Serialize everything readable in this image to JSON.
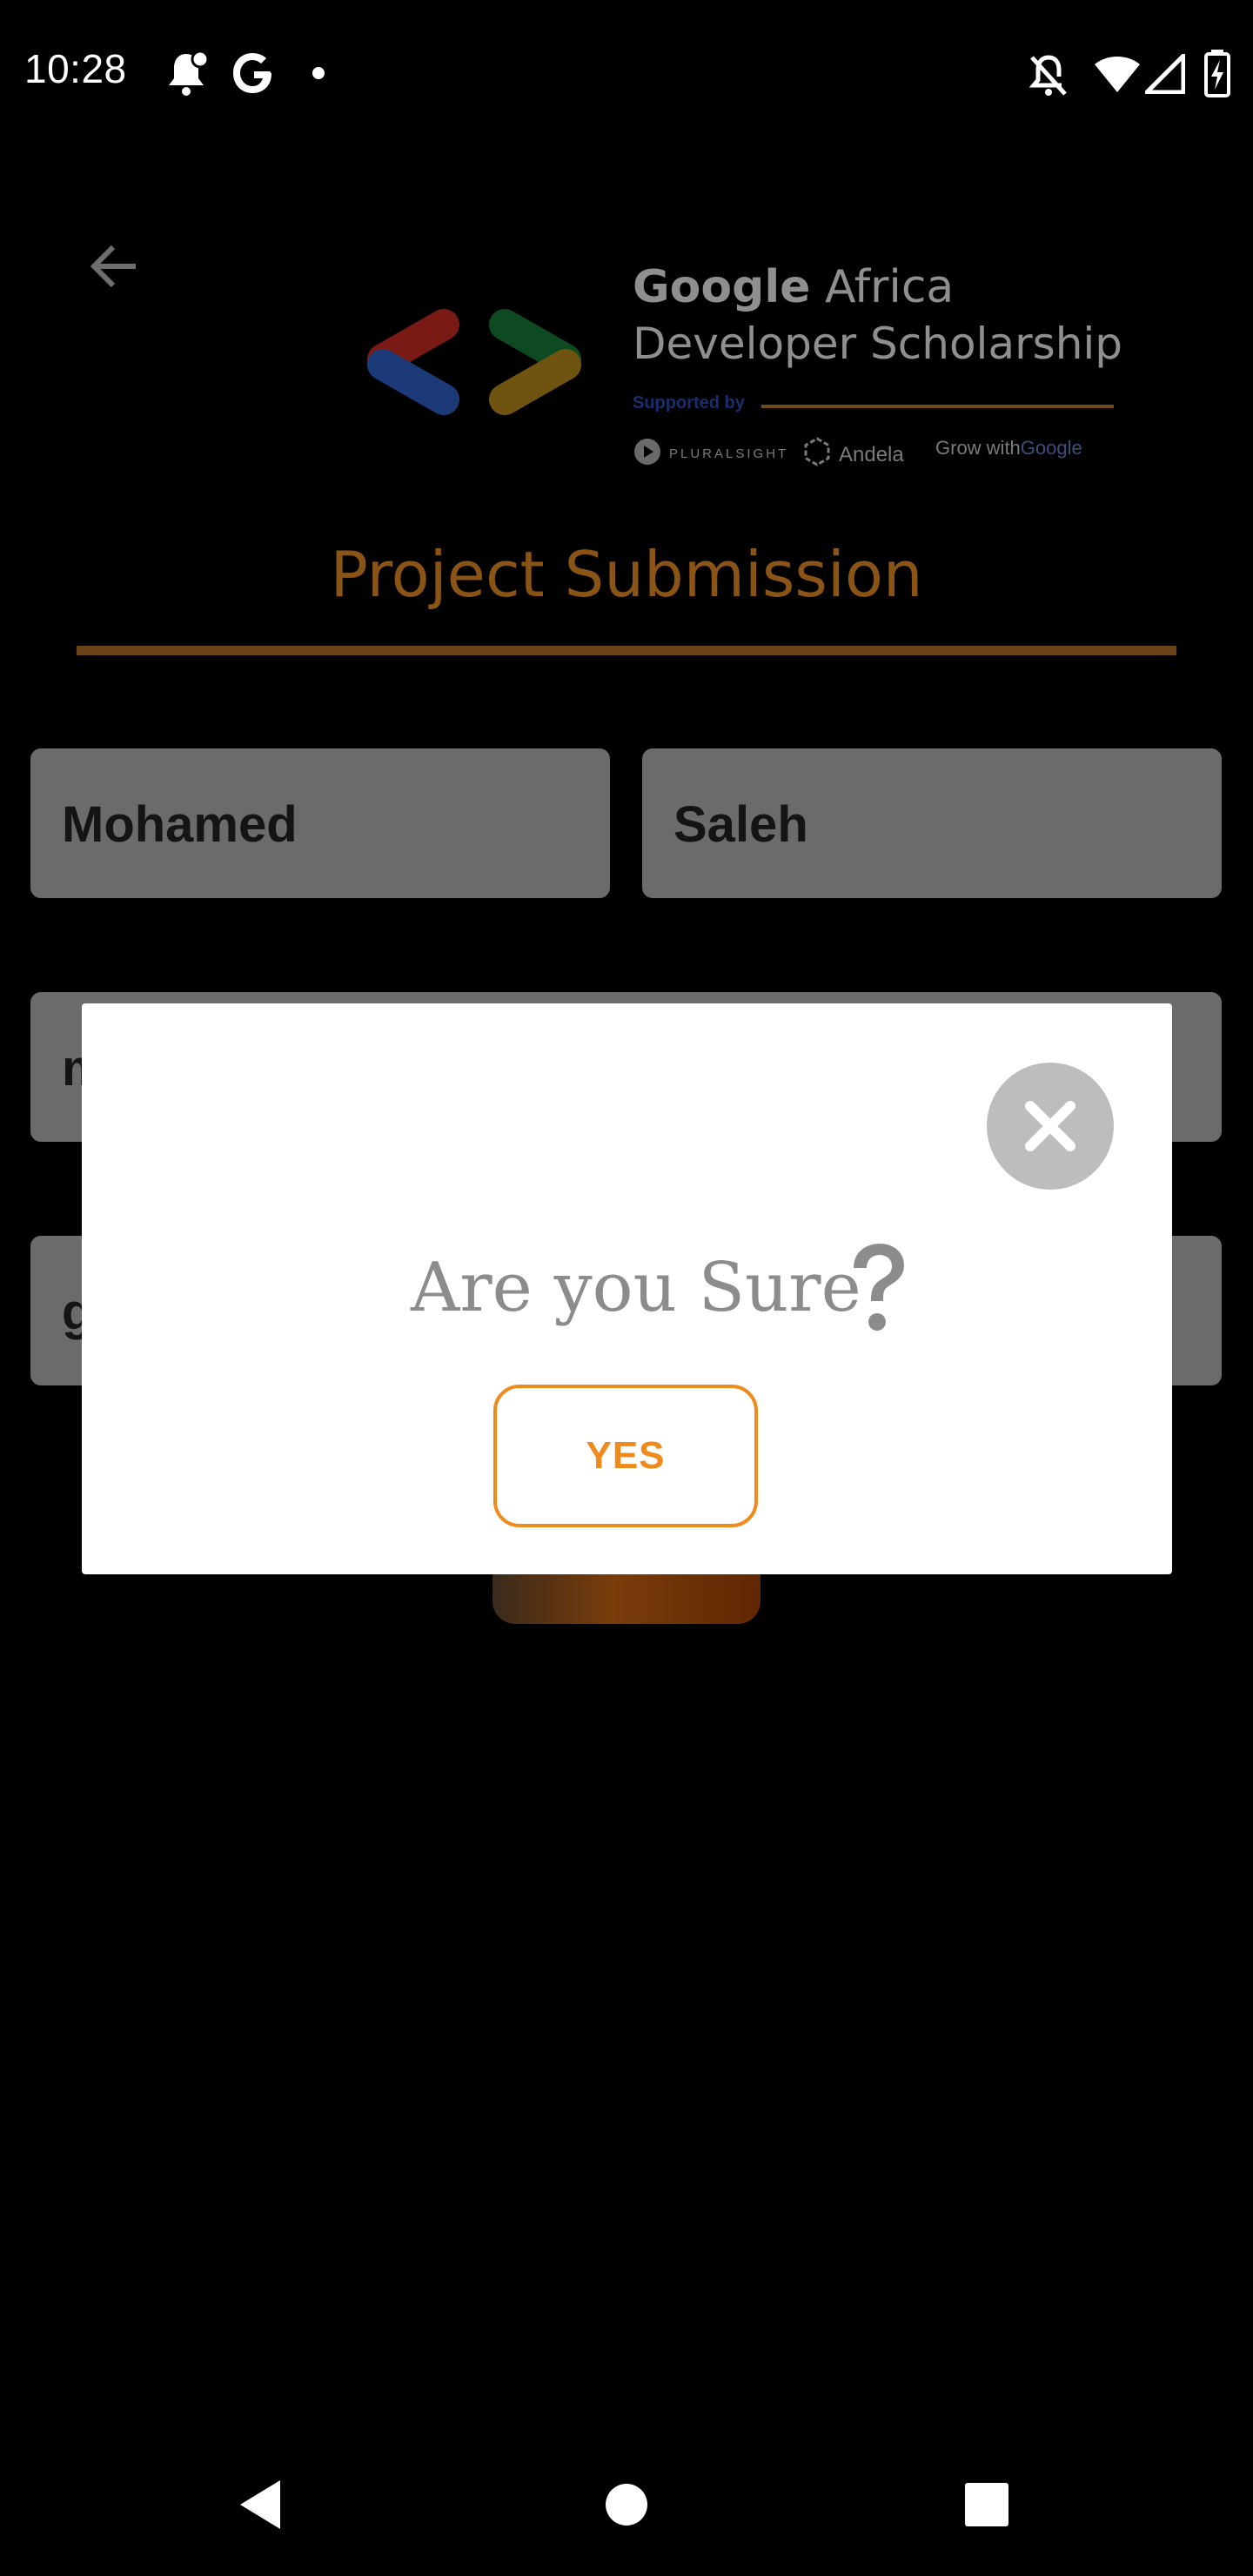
{
  "status_bar": {
    "time": "10:28",
    "left_icons": [
      "notification-bell-icon",
      "google-g-icon",
      "dot-icon"
    ],
    "right_icons": [
      "notifications-off-icon",
      "wifi-icon",
      "cell-signal-icon",
      "battery-charging-icon"
    ]
  },
  "header": {
    "back_icon": "arrow-left-icon",
    "logo": {
      "line1_bold": "Google",
      "line1_rest": " Africa",
      "line2": "Developer Scholarship",
      "supported_by": "Supported by",
      "partners": {
        "pluralsight": "PLURALSIGHT",
        "andela": "Andela",
        "grow_prefix": "Grow with ",
        "grow_google": "Google"
      }
    }
  },
  "page": {
    "title": "Project Submission",
    "accent_color": "#f08a1a"
  },
  "form": {
    "first_name": "Mohamed",
    "last_name": "Saleh",
    "email_partial": "m",
    "github_partial": "g"
  },
  "dialog": {
    "message": "Are you Sure",
    "question_icon": "question-mark-icon",
    "close_icon": "close-icon",
    "yes_label": "YES"
  },
  "nav_bar": {
    "buttons": [
      "back-triangle-icon",
      "home-circle-icon",
      "recents-square-icon"
    ]
  }
}
